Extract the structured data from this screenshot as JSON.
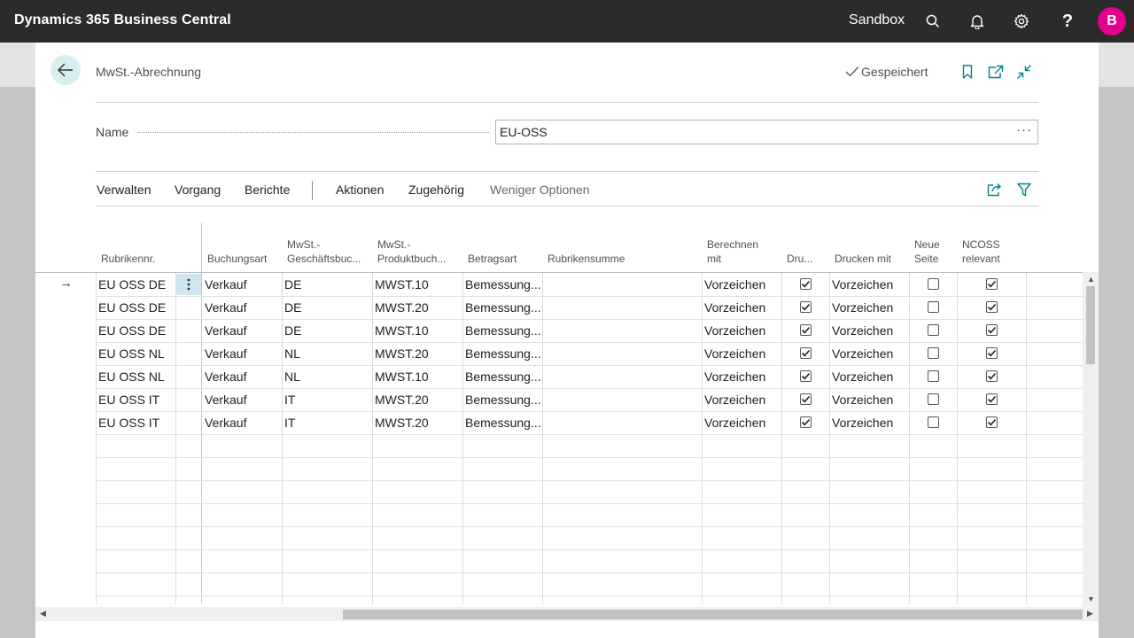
{
  "app": {
    "title": "Dynamics 365 Business Central",
    "environment": "Sandbox",
    "avatar_initial": "B",
    "avatar_color": "#e3008c"
  },
  "page": {
    "caption": "MwSt.-Abrechnung",
    "status": "Gespeichert",
    "name_label": "Name",
    "name_value": "EU-OSS",
    "field_ellipsis": "···"
  },
  "actions": {
    "verwalten": "Verwalten",
    "vorgang": "Vorgang",
    "berichte": "Berichte",
    "aktionen": "Aktionen",
    "zugehoerig": "Zugehörig",
    "weniger": "Weniger Optionen"
  },
  "grid": {
    "headers": {
      "rubrikennr": "Rubrikennr.",
      "buchungsart": "Buchungsart",
      "geschaeft_1": "MwSt.-",
      "geschaeft_2": "Geschäftsbuc...",
      "produkt_1": "MwSt.-",
      "produkt_2": "Produktbuch...",
      "betragsart": "Betragsart",
      "rubrikensumme": "Rubrikensumme",
      "berechnen_1": "Berechnen",
      "berechnen_2": "mit",
      "drucken": "Dru...",
      "drucken_mit": "Drucken mit",
      "neue_1": "Neue",
      "neue_2": "Seite",
      "ncoss_1": "NCOSS",
      "ncoss_2": "relevant"
    },
    "rows": [
      {
        "rubrik": "EU OSS DE",
        "buchungsart": "Verkauf",
        "geschaeft": "DE",
        "produkt": "MWST.10",
        "betragsart": "Bemessung...",
        "summe": "",
        "berechnen": "Vorzeichen",
        "drucken": true,
        "drucken_mit": "Vorzeichen",
        "neue_seite": false,
        "ncoss": true
      },
      {
        "rubrik": "EU OSS DE",
        "buchungsart": "Verkauf",
        "geschaeft": "DE",
        "produkt": "MWST.20",
        "betragsart": "Bemessung...",
        "summe": "",
        "berechnen": "Vorzeichen",
        "drucken": true,
        "drucken_mit": "Vorzeichen",
        "neue_seite": false,
        "ncoss": true
      },
      {
        "rubrik": "EU OSS DE",
        "buchungsart": "Verkauf",
        "geschaeft": "DE",
        "produkt": "MWST.10",
        "betragsart": "Bemessung...",
        "summe": "",
        "berechnen": "Vorzeichen",
        "drucken": true,
        "drucken_mit": "Vorzeichen",
        "neue_seite": false,
        "ncoss": true
      },
      {
        "rubrik": "EU OSS NL",
        "buchungsart": "Verkauf",
        "geschaeft": "NL",
        "produkt": "MWST.20",
        "betragsart": "Bemessung...",
        "summe": "",
        "berechnen": "Vorzeichen",
        "drucken": true,
        "drucken_mit": "Vorzeichen",
        "neue_seite": false,
        "ncoss": true
      },
      {
        "rubrik": "EU OSS NL",
        "buchungsart": "Verkauf",
        "geschaeft": "NL",
        "produkt": "MWST.10",
        "betragsart": "Bemessung...",
        "summe": "",
        "berechnen": "Vorzeichen",
        "drucken": true,
        "drucken_mit": "Vorzeichen",
        "neue_seite": false,
        "ncoss": true
      },
      {
        "rubrik": "EU OSS IT",
        "buchungsart": "Verkauf",
        "geschaeft": "IT",
        "produkt": "MWST.20",
        "betragsart": "Bemessung...",
        "summe": "",
        "berechnen": "Vorzeichen",
        "drucken": true,
        "drucken_mit": "Vorzeichen",
        "neue_seite": false,
        "ncoss": true
      },
      {
        "rubrik": "EU OSS IT",
        "buchungsart": "Verkauf",
        "geschaeft": "IT",
        "produkt": "MWST.20",
        "betragsart": "Bemessung...",
        "summe": "",
        "berechnen": "Vorzeichen",
        "drucken": true,
        "drucken_mit": "Vorzeichen",
        "neue_seite": false,
        "ncoss": true
      }
    ],
    "selected_row": 0
  },
  "colors": {
    "appbar": "#2b2b2b",
    "accent": "#008489",
    "back_button_bg": "#d9eef0",
    "row_menu_bg": "#cfe5ef"
  }
}
